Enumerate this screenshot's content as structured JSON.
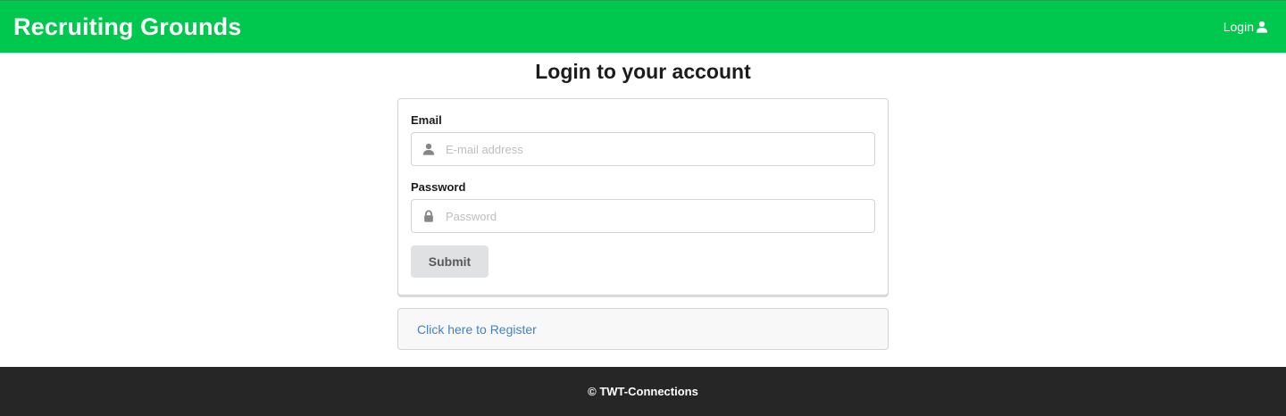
{
  "navbar": {
    "brand": "Recruiting Grounds",
    "login_label": "Login",
    "login_icon": "user-icon",
    "background_color": "#00c74d"
  },
  "page": {
    "title": "Login to your account"
  },
  "form": {
    "email_label": "Email",
    "email_placeholder": "E-mail address",
    "email_value": "",
    "email_icon": "user-icon",
    "password_label": "Password",
    "password_placeholder": "Password",
    "password_value": "",
    "password_icon": "lock-icon",
    "submit_label": "Submit"
  },
  "register": {
    "link_text": "Click here to Register",
    "link_color": "#4183c4"
  },
  "footer": {
    "text": "© TWT-Connections",
    "background_color": "#262626"
  }
}
